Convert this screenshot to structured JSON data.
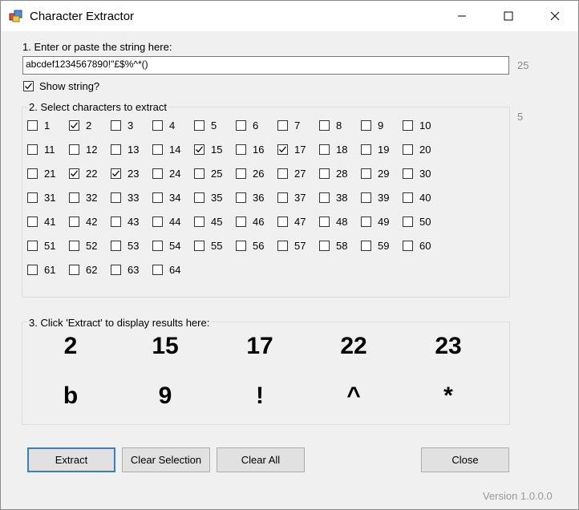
{
  "window": {
    "title": "Character Extractor",
    "icon": "app-icon",
    "controls": [
      "minimize-icon",
      "maximize-icon",
      "close-icon"
    ]
  },
  "step1": {
    "label": "1. Enter or paste the string here:",
    "value": "abcdef1234567890!\"£$%^*()",
    "length": "25"
  },
  "show_string": {
    "label": "Show string?",
    "checked": true
  },
  "step2": {
    "label": "2. Select characters to extract",
    "selected_count": "5",
    "checkboxes": [
      {
        "label": "1",
        "checked": false
      },
      {
        "label": "2",
        "checked": true
      },
      {
        "label": "3",
        "checked": false
      },
      {
        "label": "4",
        "checked": false
      },
      {
        "label": "5",
        "checked": false
      },
      {
        "label": "6",
        "checked": false
      },
      {
        "label": "7",
        "checked": false
      },
      {
        "label": "8",
        "checked": false
      },
      {
        "label": "9",
        "checked": false
      },
      {
        "label": "10",
        "checked": false
      },
      {
        "label": "11",
        "checked": false
      },
      {
        "label": "12",
        "checked": false
      },
      {
        "label": "13",
        "checked": false
      },
      {
        "label": "14",
        "checked": false
      },
      {
        "label": "15",
        "checked": true
      },
      {
        "label": "16",
        "checked": false
      },
      {
        "label": "17",
        "checked": true
      },
      {
        "label": "18",
        "checked": false
      },
      {
        "label": "19",
        "checked": false
      },
      {
        "label": "20",
        "checked": false
      },
      {
        "label": "21",
        "checked": false
      },
      {
        "label": "22",
        "checked": true
      },
      {
        "label": "23",
        "checked": true
      },
      {
        "label": "24",
        "checked": false
      },
      {
        "label": "25",
        "checked": false
      },
      {
        "label": "26",
        "checked": false
      },
      {
        "label": "27",
        "checked": false
      },
      {
        "label": "28",
        "checked": false
      },
      {
        "label": "29",
        "checked": false
      },
      {
        "label": "30",
        "checked": false
      },
      {
        "label": "31",
        "checked": false
      },
      {
        "label": "32",
        "checked": false
      },
      {
        "label": "33",
        "checked": false
      },
      {
        "label": "34",
        "checked": false
      },
      {
        "label": "35",
        "checked": false
      },
      {
        "label": "36",
        "checked": false
      },
      {
        "label": "37",
        "checked": false
      },
      {
        "label": "38",
        "checked": false
      },
      {
        "label": "39",
        "checked": false
      },
      {
        "label": "40",
        "checked": false
      },
      {
        "label": "41",
        "checked": false
      },
      {
        "label": "42",
        "checked": false
      },
      {
        "label": "43",
        "checked": false
      },
      {
        "label": "44",
        "checked": false
      },
      {
        "label": "45",
        "checked": false
      },
      {
        "label": "46",
        "checked": false
      },
      {
        "label": "47",
        "checked": false
      },
      {
        "label": "48",
        "checked": false
      },
      {
        "label": "49",
        "checked": false
      },
      {
        "label": "50",
        "checked": false
      },
      {
        "label": "51",
        "checked": false
      },
      {
        "label": "52",
        "checked": false
      },
      {
        "label": "53",
        "checked": false
      },
      {
        "label": "54",
        "checked": false
      },
      {
        "label": "55",
        "checked": false
      },
      {
        "label": "56",
        "checked": false
      },
      {
        "label": "57",
        "checked": false
      },
      {
        "label": "58",
        "checked": false
      },
      {
        "label": "59",
        "checked": false
      },
      {
        "label": "60",
        "checked": false
      },
      {
        "label": "61",
        "checked": false
      },
      {
        "label": "62",
        "checked": false
      },
      {
        "label": "63",
        "checked": false
      },
      {
        "label": "64",
        "checked": false
      }
    ]
  },
  "step3": {
    "label": "3. Click 'Extract' to display results here:",
    "positions": [
      "2",
      "15",
      "17",
      "22",
      "23"
    ],
    "characters": [
      "b",
      "9",
      "!",
      "^",
      "*"
    ]
  },
  "buttons": {
    "extract": "Extract",
    "clear_selection": "Clear Selection",
    "clear_all": "Clear All",
    "close": "Close"
  },
  "version": "Version 1.0.0.0"
}
